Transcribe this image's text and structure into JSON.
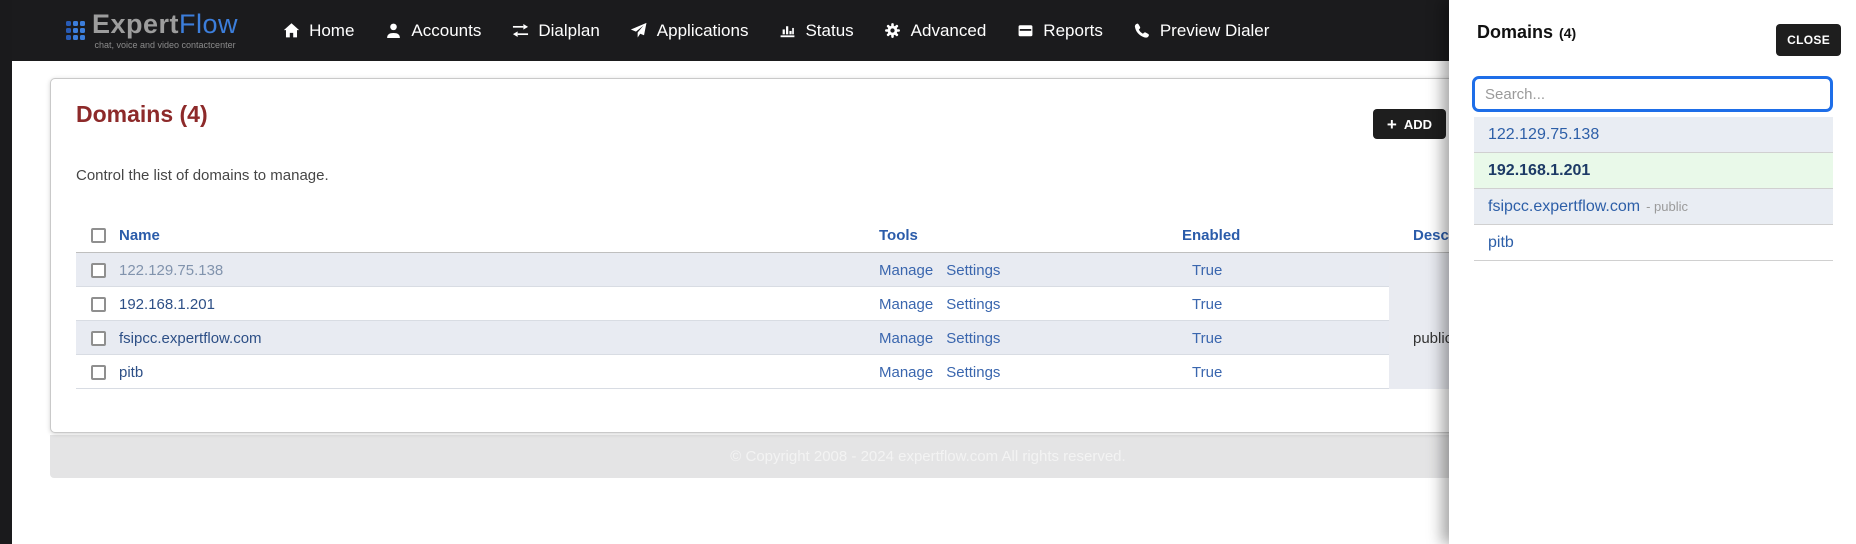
{
  "brand": {
    "name_primary": "Expert",
    "name_secondary": "Flow",
    "tagline": "chat, voice and video contactcenter"
  },
  "nav": {
    "items": [
      {
        "label": "Home",
        "icon": "home-icon"
      },
      {
        "label": "Accounts",
        "icon": "person-icon"
      },
      {
        "label": "Dialplan",
        "icon": "swap-arrows-icon"
      },
      {
        "label": "Applications",
        "icon": "paper-plane-icon"
      },
      {
        "label": "Status",
        "icon": "bar-chart-icon"
      },
      {
        "label": "Advanced",
        "icon": "gear-icon"
      },
      {
        "label": "Reports",
        "icon": "drive-icon"
      },
      {
        "label": "Preview Dialer",
        "icon": "phone-icon"
      }
    ]
  },
  "main": {
    "title": "Domains (4)",
    "subtitle": "Control the list of domains to manage.",
    "add_plus": "+",
    "add_label": "ADD",
    "table": {
      "headers": {
        "name": "Name",
        "tools": "Tools",
        "enabled": "Enabled",
        "description": "Description"
      },
      "rows": [
        {
          "name": "122.129.75.138",
          "tools": [
            "Manage",
            "Settings"
          ],
          "enabled": "True",
          "description": ""
        },
        {
          "name": "192.168.1.201",
          "tools": [
            "Manage",
            "Settings"
          ],
          "enabled": "True",
          "description": ""
        },
        {
          "name": "fsipcc.expertflow.com",
          "tools": [
            "Manage",
            "Settings"
          ],
          "enabled": "True",
          "description": "public"
        },
        {
          "name": "pitb",
          "tools": [
            "Manage",
            "Settings"
          ],
          "enabled": "True",
          "description": ""
        }
      ]
    }
  },
  "footer": {
    "copyright": "© Copyright 2008 - 2024 expertflow.com All rights reserved."
  },
  "panel": {
    "title": "Domains",
    "count": "(4)",
    "close_label": "CLOSE",
    "search_value": "",
    "search_placeholder": "Search...",
    "items": [
      {
        "label": "122.129.75.138",
        "suffix": ""
      },
      {
        "label": "192.168.1.201",
        "suffix": ""
      },
      {
        "label": "fsipcc.expertflow.com",
        "suffix": "- public"
      },
      {
        "label": "pitb",
        "suffix": ""
      }
    ]
  },
  "colors": {
    "navbar_bg": "#1b1b1d",
    "brand_gray": "#9d9d9d",
    "brand_blue": "#3c7edb",
    "heading_red": "#8d2a2a",
    "header_blue": "#2b5caa",
    "link_blue": "#3a66ae",
    "row_shaded": "#e8ebf2",
    "desc_col_bg": "#e9ebf1",
    "button_dark": "#1e1e1e",
    "search_border_blue": "#1e6ee8",
    "selected_item_green": "#e9f9e9",
    "item_gray": "#e9edf3",
    "footer_bg": "#e4e4e5"
  }
}
